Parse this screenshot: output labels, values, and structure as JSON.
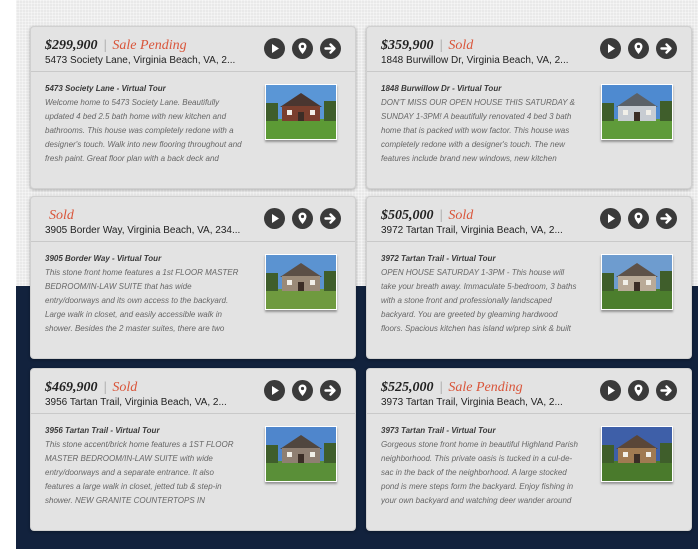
{
  "listings": [
    {
      "price": "$299,900",
      "separator": "|",
      "status": "Sale Pending",
      "address": "5473 Society Lane, Virginia Beach, VA, 2...",
      "tour_title": "5473 Society Lane - Virtual Tour",
      "description": "Welcome home to 5473 Society Lane. Beautifully updated 4 bed 2.5 bath home with new kitchen and bathrooms. This house was completely redone with a designer's touch. Walk into new flooring throughout and fresh paint. Great floor plan with a back deck and",
      "thumb": {
        "sky": "#5a96d6",
        "house": "#7a3f2e",
        "roof": "#4a3630",
        "lawn": "#5c9a35"
      }
    },
    {
      "price": "$359,900",
      "separator": "|",
      "status": "Sold",
      "address": "1848 Burwillow Dr, Virginia Beach, VA, 2...",
      "tour_title": "1848 Burwillow Dr - Virtual Tour",
      "description": "DON'T MISS OUR OPEN HOUSE THIS SATURDAY & SUNDAY 1-3PM! A beautifully renovated 4 bed 3 bath home that is packed with wow factor. This house was completely redone with a designer's touch. The new features include brand new windows, new kitchen",
      "thumb": {
        "sky": "#4e8ad0",
        "house": "#c7ccd2",
        "roof": "#5b6168",
        "lawn": "#5f9b3a"
      }
    },
    {
      "price": "",
      "separator": "",
      "status": "Sold",
      "address": "3905 Border Way, Virginia Beach, VA, 234...",
      "tour_title": "3905 Border Way - Virtual Tour",
      "description": "This stone front home features a 1st FLOOR MASTER BEDROOM/IN-LAW SUITE that has wide entry/doorways and its own access to the backyard. Large walk in closet, and easily accessible walk in shower. Besides the 2 master suites, there are two",
      "thumb": {
        "sky": "#5b93d1",
        "house": "#9a8a78",
        "roof": "#5b4f46",
        "lawn": "#6f9a3f"
      }
    },
    {
      "price": "$505,000",
      "separator": "|",
      "status": "Sold",
      "address": "3972 Tartan Trail, Virginia Beach, VA, 2...",
      "tour_title": "3972 Tartan Trail - Virtual Tour",
      "description": "OPEN HOUSE SATURDAY 1-3PM - This house will take your breath away. Immaculate 5-bedroom, 3 baths with a stone front and professionally landscaped backyard. You are greeted by gleaming hardwood floors. Spacious kitchen has island w/prep sink & built",
      "thumb": {
        "sky": "#6e9ccf",
        "house": "#b9aa98",
        "roof": "#5e5249",
        "lawn": "#4c7e2d"
      }
    },
    {
      "price": "$469,900",
      "separator": "|",
      "status": "Sold",
      "address": "3956 Tartan Trail, Virginia Beach, VA, 2...",
      "tour_title": "3956 Tartan Trail - Virtual Tour",
      "description": "This stone accent/brick home features a 1ST FLOOR MASTER BEDROOM/IN-LAW SUITE with wide entry/doorways and a separate entrance. It also features a large walk in closet, jetted tub & step-in shower. NEW GRANITE COUNTERTOPS IN",
      "thumb": {
        "sky": "#4f86cc",
        "house": "#8f7f72",
        "roof": "#50463f",
        "lawn": "#5a8f38"
      }
    },
    {
      "price": "$525,000",
      "separator": "|",
      "status": "Sale Pending",
      "address": "3973 Tartan Trail, Virginia Beach, VA, 2...",
      "tour_title": "3973 Tartan Trail - Virtual Tour",
      "description": "Gorgeous stone front home in beautiful Highland Parish neighborhood. This private oasis is tucked in a cul-de-sac in the back of the neighborhood. A large stocked pond is mere steps form the backyard. Enjoy fishing in your own backyard and watching deer wander around",
      "thumb": {
        "sky": "#3e5fa8",
        "house": "#a07a52",
        "roof": "#5a4638",
        "lawn": "#4a7a2c"
      }
    }
  ],
  "icons": [
    "play-icon",
    "map-pin-icon",
    "arrow-right-icon"
  ],
  "colors": {
    "status": "#d9553a",
    "navy": "#12223d",
    "icon_bg": "#3a3a3a"
  }
}
